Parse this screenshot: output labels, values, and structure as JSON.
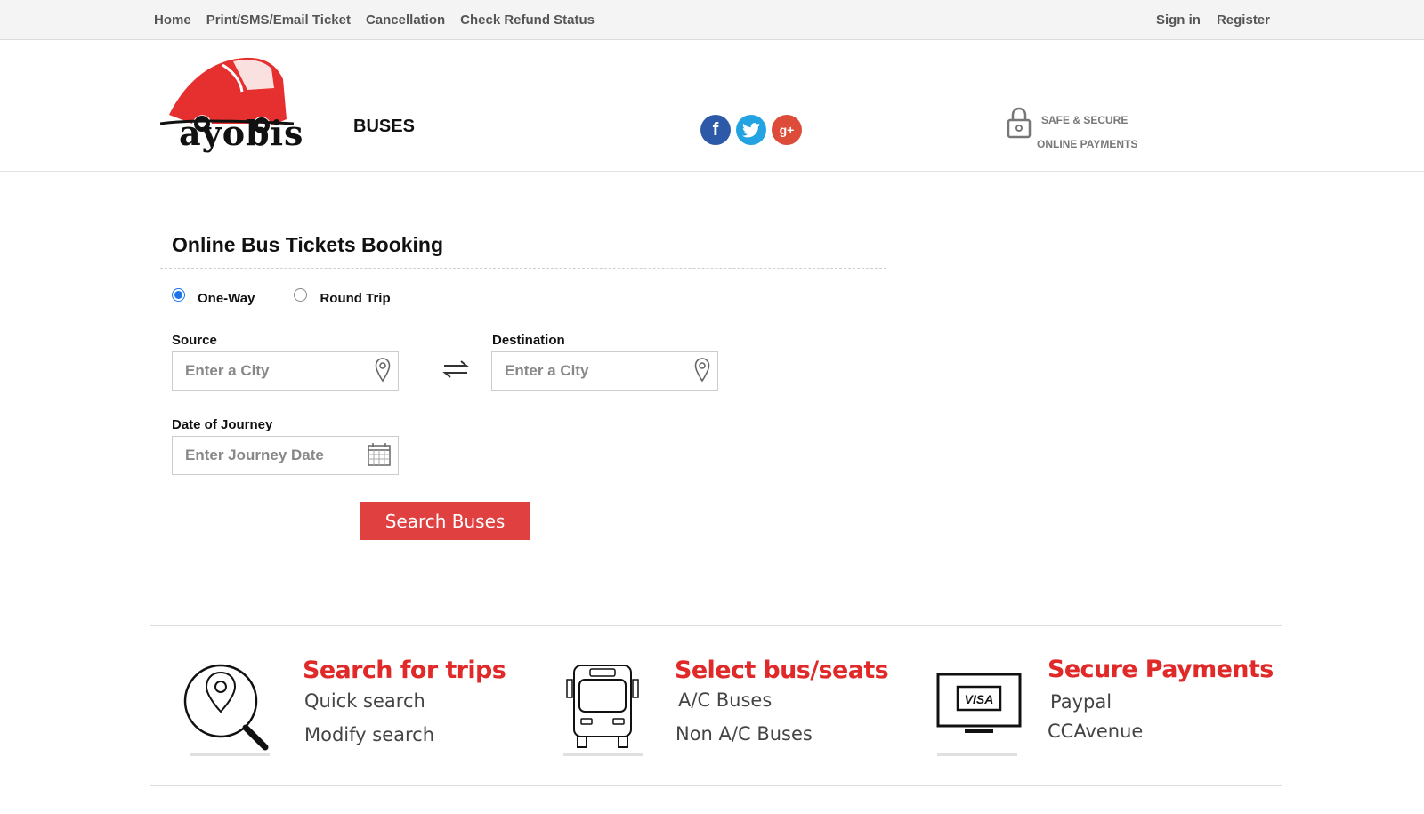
{
  "topnav": {
    "left": [
      "Home",
      "Print/SMS/Email Ticket",
      "Cancellation",
      "Check Refund Status"
    ],
    "right": [
      "Sign in",
      "Register"
    ]
  },
  "header": {
    "logo_text": "ayobis",
    "section_label": "BUSES",
    "social": {
      "facebook": "f",
      "twitter": "t",
      "google_plus": "g+"
    },
    "secure_line1": "SAFE & SECURE",
    "secure_line2": "ONLINE PAYMENTS"
  },
  "booking": {
    "title": "Online Bus Tickets Booking",
    "trip_types": [
      "One-Way",
      "Round Trip"
    ],
    "selected_trip_type": "One-Way",
    "source_label": "Source",
    "source_placeholder": "Enter a City",
    "source_value": "",
    "destination_label": "Destination",
    "destination_placeholder": "Enter a City",
    "destination_value": "",
    "date_label": "Date of Journey",
    "date_placeholder": "Enter Journey Date",
    "date_value": "",
    "search_button": "Search Buses"
  },
  "features": [
    {
      "title": "Search for trips",
      "lines": [
        "Quick search",
        "Modify search"
      ],
      "icon": "search-location-icon"
    },
    {
      "title": "Select bus/seats",
      "lines": [
        "A/C Buses",
        "Non A/C Buses"
      ],
      "icon": "bus-icon"
    },
    {
      "title": "Secure Payments",
      "lines": [
        "Paypal",
        "CCAvenue"
      ],
      "icon": "visa-monitor-icon"
    }
  ],
  "colors": {
    "brand_red": "#e04040",
    "feature_title_red": "#e02a2a",
    "radio_blue": "#1a73e8",
    "facebook": "#2d5aa8",
    "twitter": "#23a3e2",
    "google_plus": "#dd4b39"
  }
}
